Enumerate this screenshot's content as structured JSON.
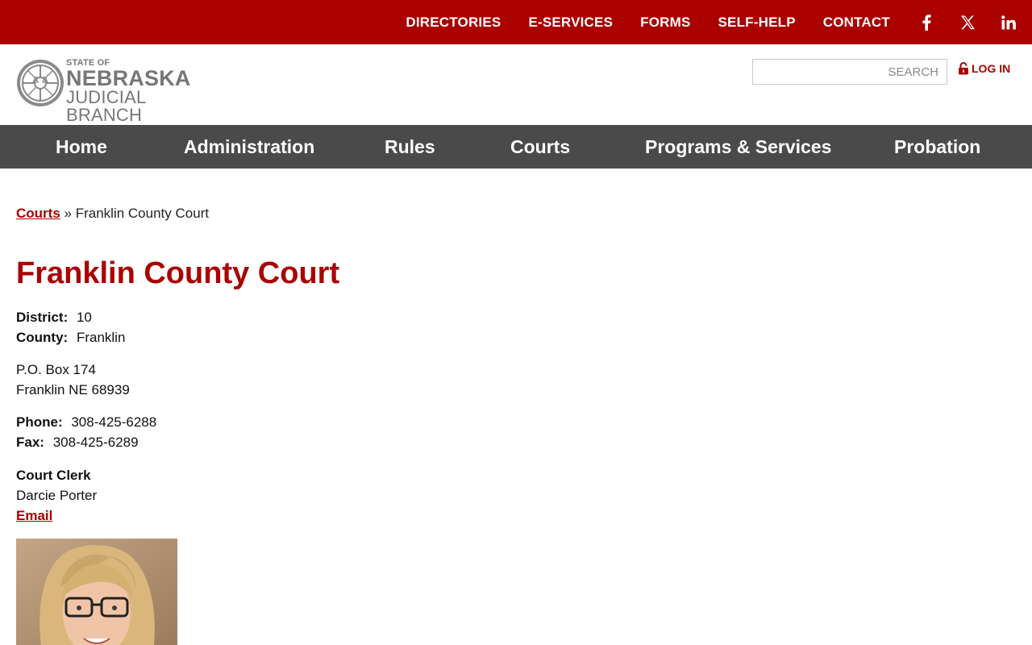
{
  "top_nav": {
    "items": [
      "DIRECTORIES",
      "E-SERVICES",
      "FORMS",
      "SELF-HELP",
      "CONTACT"
    ],
    "social": [
      "facebook-icon",
      "x-icon",
      "linkedin-icon"
    ]
  },
  "logo": {
    "line1": "STATE OF",
    "line2": "NEBRASKA",
    "line3": "JUDICIAL BRANCH"
  },
  "search": {
    "placeholder": "SEARCH"
  },
  "login": {
    "label": "LOG IN"
  },
  "main_nav": [
    "Home",
    "Administration",
    "Rules",
    "Courts",
    "Programs & Services",
    "Probation"
  ],
  "breadcrumb": {
    "parent": "Courts",
    "separator": "»",
    "current": "Franklin County Court"
  },
  "page_title": "Franklin County Court",
  "details": {
    "district_label": "District:",
    "district_value": "10",
    "county_label": "County:",
    "county_value": "Franklin",
    "address_line1": "P.O. Box 174",
    "address_line2": "Franklin NE 68939",
    "phone_label": "Phone:",
    "phone_value": "308-425-6288",
    "fax_label": "Fax:",
    "fax_value": "308-425-6289",
    "clerk_title": "Court Clerk",
    "clerk_name": "Darcie Porter",
    "email_label": "Email"
  },
  "colors": {
    "brand_red": "#ab0000",
    "nav_gray": "#4a4a4a"
  }
}
